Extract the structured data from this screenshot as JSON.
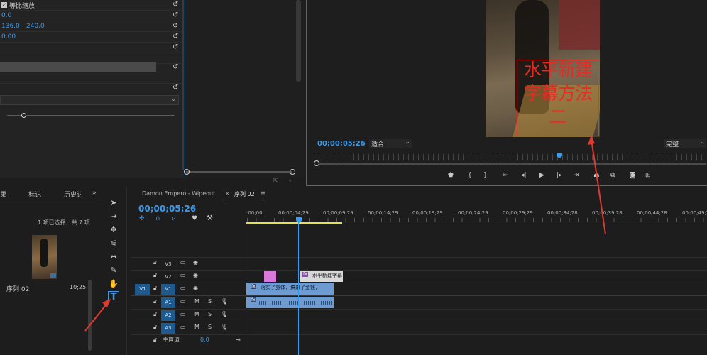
{
  "effect_controls": {
    "uniform_scale_label": "等比缩放",
    "value_row1": "0.0",
    "value_row2a": "136.0",
    "value_row2b": "240.0",
    "value_row3": "0.00"
  },
  "program_monitor": {
    "timecode": "00;00;05;26",
    "fit_label": "适合",
    "quality_label": "完整",
    "overlay_title_line1": "水平新建",
    "overlay_title_line2": "字幕方法",
    "overlay_title_line3": "二"
  },
  "project_panel": {
    "tab_partial": "果",
    "tab_markers": "标记",
    "tab_history": "历史记",
    "more_icon": "chevrons-right-icon",
    "selection_info": "1 项已选择，共 7 项",
    "item_name": "序列 02",
    "item_duration": "10;25"
  },
  "timeline": {
    "tab_other": "Damon Empero - Wipeout",
    "tab_active": "序列 02",
    "timecode": "00;00;05;26",
    "ruler_labels": [
      ":00;00",
      "00;00;04;29",
      "00;00;09;29",
      "00;00;14;29",
      "00;00;19;29",
      "00;00;24;29",
      "00;00;29;29",
      "00;00;34;28",
      "00;00;39;28",
      "00;00;44;28",
      "00;00;49;2"
    ],
    "tracks": {
      "v3": "V3",
      "v2": "V2",
      "v1": "V1",
      "v1_source": "V1",
      "a1": "A1",
      "a2": "A2",
      "a3": "A3",
      "master": "主声道",
      "master_value": "0.0"
    },
    "clips": {
      "title_clip": "水平新建字幕",
      "video_clip": "落实了身体，搞来了金钱，",
      "fx_badge": "fx"
    },
    "m_label": "M",
    "s_label": "S"
  },
  "colors": {
    "accent_blue": "#3d9ae8",
    "clip_blue": "#6d9bd1",
    "clip_pink": "#d878d8",
    "annotation_red": "#e03a2f"
  }
}
